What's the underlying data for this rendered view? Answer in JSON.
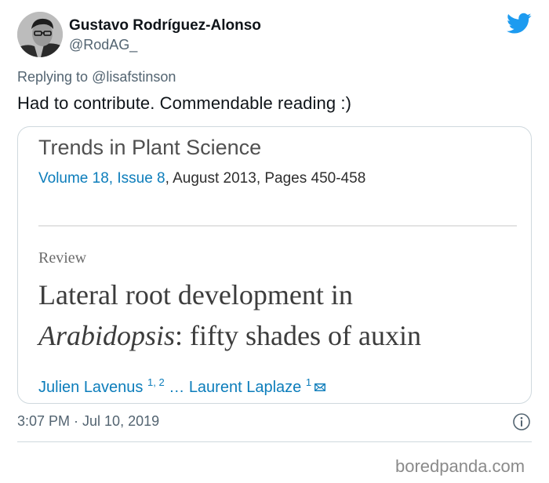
{
  "author": {
    "name": "Gustavo Rodríguez-Alonso",
    "handle": "@RodAG_"
  },
  "reply": {
    "prefix": "Replying to ",
    "to": "@lisafstinson"
  },
  "tweet": {
    "text": "Had to contribute. Commendable reading :)",
    "timestamp": "3:07 PM · Jul 10, 2019"
  },
  "card": {
    "journal": "Trends in Plant Science",
    "volume": "Volume 18, Issue 8",
    "issue_details": ", August 2013, Pages 450-458",
    "article_type": "Review",
    "title_line1": "Lateral root development in",
    "title_italic": "Arabidopsis",
    "title_rest": ": fifty shades of auxin",
    "author1": "Julien Lavenus",
    "author1_affil": "1, 2",
    "ellipsis": " … ",
    "author2": "Laurent Laplaze",
    "author2_affil": "1"
  },
  "colors": {
    "twitter_blue": "#1d9bf0",
    "link_blue": "#0c7dbb",
    "secondary_text": "#536471"
  },
  "icons": {
    "brand": "twitter-bird-icon",
    "info": "info-icon",
    "email": "envelope-icon"
  },
  "watermark": "boredpanda.com"
}
